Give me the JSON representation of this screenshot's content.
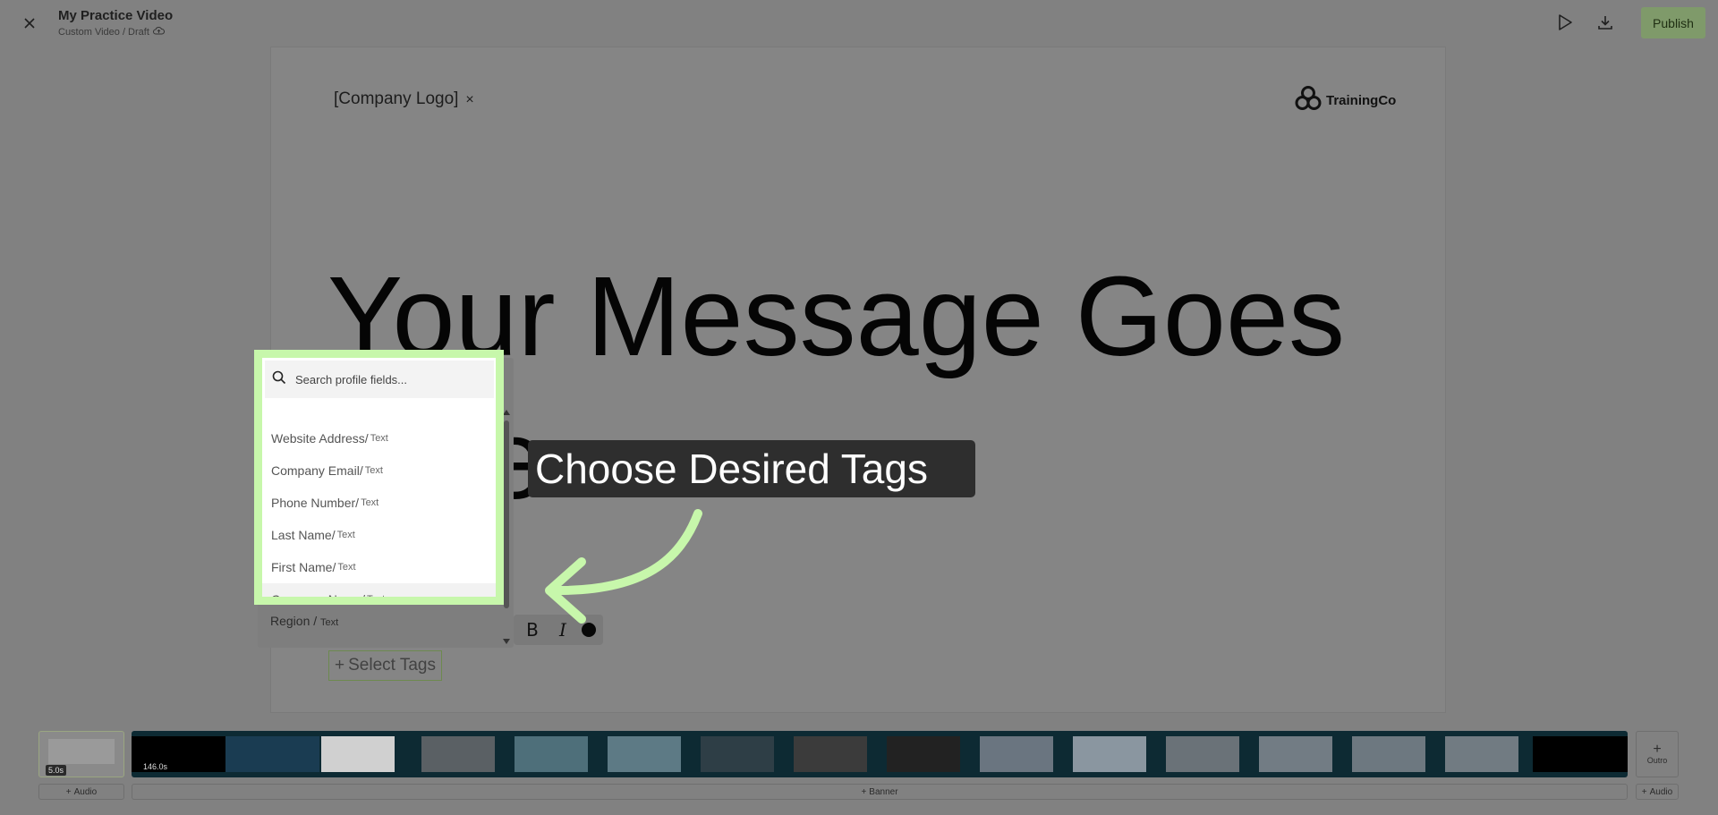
{
  "header": {
    "title": "My Practice Video",
    "subtitle": "Custom Video / Draft",
    "publish_label": "Publish"
  },
  "canvas": {
    "logo_placeholder": "[Company Logo]",
    "logo_close": "×",
    "brand_name": "TrainingCo",
    "headline_line1": "Your Message Goes",
    "headline_line2": "e"
  },
  "toolbar": {
    "bold": "B",
    "italic": "I"
  },
  "select_tags": {
    "label": "Select Tags",
    "plus": "+"
  },
  "tag_dropdown": {
    "search_placeholder": "Search profile fields...",
    "items": [
      {
        "name": "Website Address",
        "type": "Text"
      },
      {
        "name": "Company Email",
        "type": "Text"
      },
      {
        "name": "Phone Number",
        "type": "Text"
      },
      {
        "name": "Last Name",
        "type": "Text"
      },
      {
        "name": "First Name",
        "type": "Text"
      },
      {
        "name": "Company Name",
        "type": "Text"
      },
      {
        "name": "Region",
        "type": "Text"
      }
    ],
    "separator": " / "
  },
  "callout": {
    "text": "Choose Desired Tags"
  },
  "timeline": {
    "intro_duration": "5.0s",
    "main_duration": "146.0s",
    "outro_label": "Outro",
    "left_audio": "Audio",
    "banner": "Banner",
    "right_audio": "Audio"
  },
  "colors": {
    "highlight": "#c7f7ab",
    "publish": "#7f9a6a",
    "timeline_strip": "#0d2a33"
  }
}
